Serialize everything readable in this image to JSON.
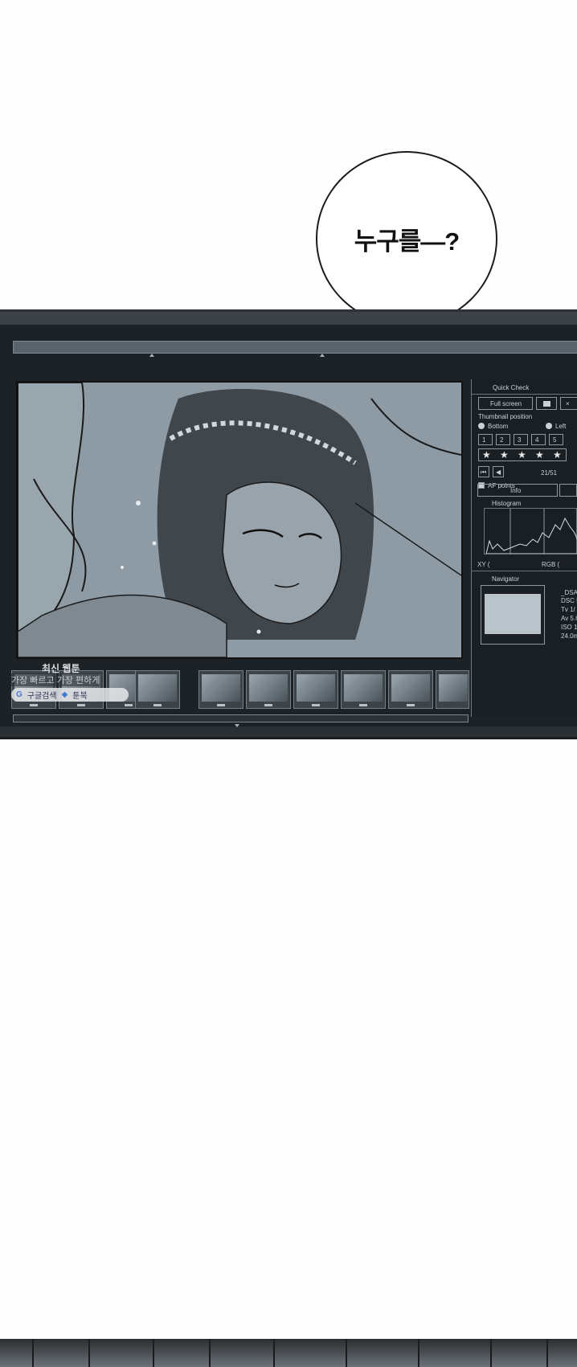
{
  "bubble": {
    "text": "누구를—?"
  },
  "panel": {
    "quick_check": "Quick Check",
    "full_screen": "Full screen",
    "thumbnail_position": "Thumbnail position",
    "bottom": "Bottom",
    "left": "Left",
    "ratings": [
      "1",
      "2",
      "3",
      "4",
      "5"
    ],
    "counter": "21/51",
    "af_points": "AF points",
    "info": "Info",
    "histogram": "Histogram",
    "xy": "XY (",
    "rgb": "RGB (",
    "navigator": "Navigator",
    "exif": [
      "_DSA",
      "DSC 5",
      "Tv 1/",
      "Av 5.6",
      "ISO 1",
      "24.0m"
    ]
  },
  "watermark": {
    "title": "최신 웹툰",
    "sub": "가장 빠르고 가장 편하게",
    "search": "구글검색",
    "brand": "툰북"
  },
  "colors": {
    "screen": "#1d2226",
    "image": "#8e9aa3",
    "panel": "#1a1f23"
  }
}
